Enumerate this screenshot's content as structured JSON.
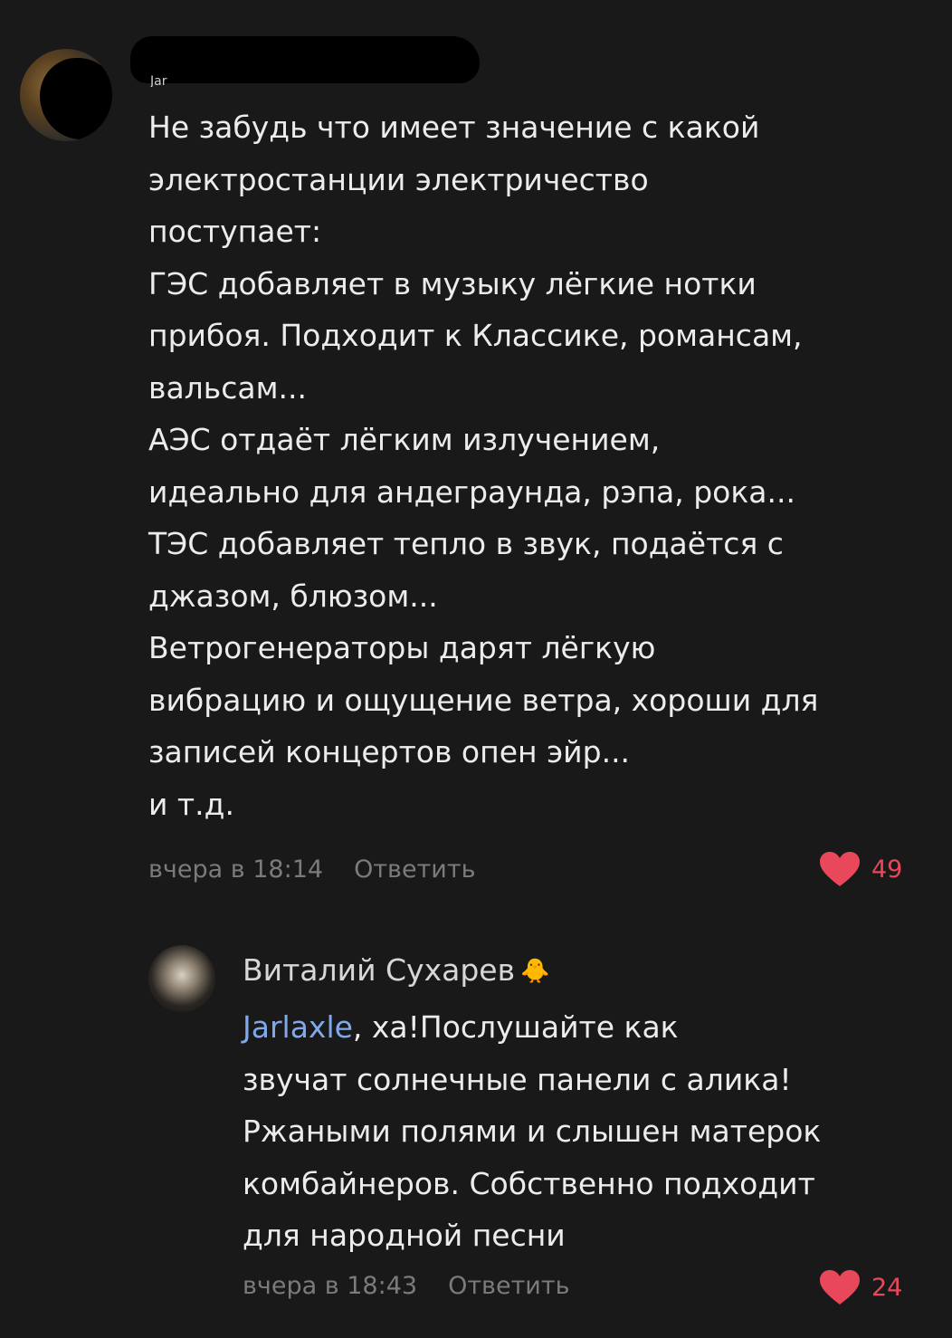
{
  "comments": [
    {
      "author_partial": "Jar",
      "lines": [
        "Не забудь что имеет значение с какой",
        "электростанции электричество",
        "поступает:",
        "ГЭС добавляет в музыку лёгкие нотки",
        "прибоя. Подходит к Классике, романсам,",
        "вальсам...",
        "АЭС отдаёт лёгким излучением,",
        "идеально для андеграунда, рэпа, рока...",
        "ТЭС добавляет тепло в звук, подаётся с",
        "джазом, блюзом...",
        "Ветрогенераторы дарят лёгкую",
        "вибрацию и ощущение ветра, хороши для",
        "записей концертов опен эйр...",
        "и т.д."
      ],
      "time": "вчера в 18:14",
      "reply_label": "Ответить",
      "likes": "49"
    },
    {
      "author": "Виталий Сухарев",
      "author_emoji": "🐥",
      "mention": "Jarlaxle",
      "lines": [
        ", ха!Послушайте как",
        "звучат солнечные панели с алика!",
        "Ржаными полями и слышен матерок",
        "комбайнеров. Собственно подходит",
        "для народной песни"
      ],
      "time": "вчера в 18:43",
      "reply_label": "Ответить",
      "likes": "24"
    }
  ],
  "colors": {
    "background": "#19191a",
    "text": "#ececec",
    "meta": "#7b7b7b",
    "mention": "#7fa9ea",
    "like": "#e8485a"
  }
}
